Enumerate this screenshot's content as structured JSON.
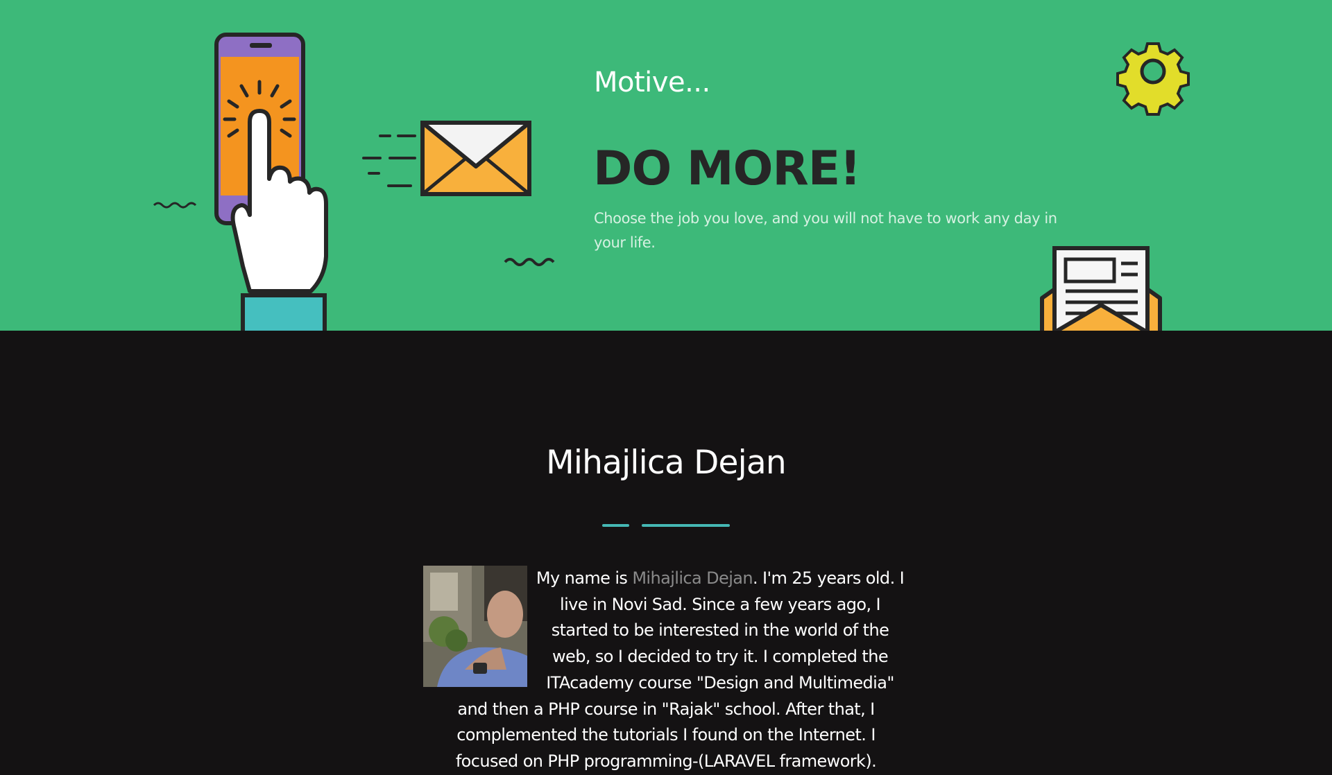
{
  "hero": {
    "motive": "Motive...",
    "headline": "DO MORE!",
    "tagline": "Choose the job you love, and you will not have to work any day in your life.",
    "icons": [
      "phone-tap-icon",
      "envelope-icon",
      "gear-icon",
      "newsletter-icon"
    ]
  },
  "about": {
    "name": "Mihajlica Dejan",
    "bio_before": "My name is ",
    "bio_name": "Mihajlica Dejan",
    "bio_after": ". I'm 25 years old. I live in Novi Sad. Since a few years ago, I started to be interested in the world of the web, so I decided to try it. I completed the ITAcademy course \"Design and Multimedia\" and then a PHP course in \"Rajak\" school. After that, I complemented the tutorials I found on the Internet. I focused on PHP programming-(LARAVEL framework).",
    "photo": "profile-photo"
  },
  "colors": {
    "hero_bg": "#3db979",
    "page_bg": "#141213",
    "accent": "#45b8b4",
    "headline": "#262626",
    "muted_name": "#8a8a8a"
  }
}
